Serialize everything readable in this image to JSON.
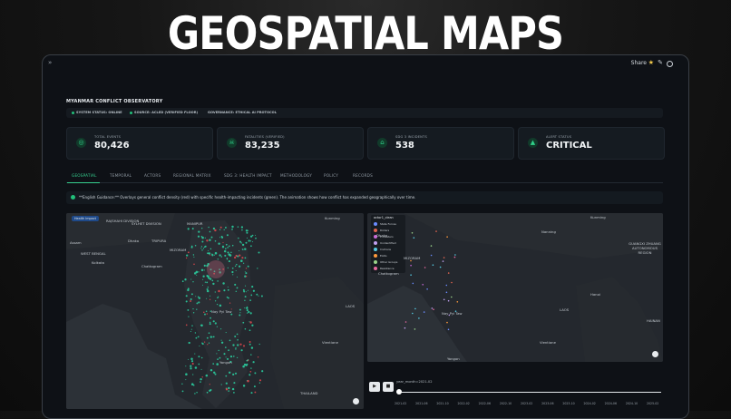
{
  "headline": "GEOSPATIAL MAPS",
  "topbar": {
    "collapse": "»",
    "share": "Share",
    "star_icon": "star-icon",
    "pencil_icon": "pencil-icon",
    "github_icon": "github-icon"
  },
  "dashboard": {
    "title": "MYANMAR CONFLICT OBSERVATORY",
    "status": [
      "SYSTEM STATUS: ONLINE",
      "SOURCE: ACLED (VERIFIED FLOOR)",
      "GOVERNANCE: ETHICAL AI PROTOCOL"
    ]
  },
  "kpis": [
    {
      "label": "TOTAL EVENTS",
      "value": "80,426",
      "icon": "target-icon"
    },
    {
      "label": "FATALITIES (VERIFIED)",
      "value": "83,235",
      "icon": "skull-icon"
    },
    {
      "label": "SDG 3 INCIDENTS",
      "value": "538",
      "icon": "home-icon"
    },
    {
      "label": "ALERT STATUS",
      "value": "CRITICAL",
      "icon": "warning-icon"
    }
  ],
  "tabs": [
    "GEOSPATIAL",
    "TEMPORAL",
    "ACTORS",
    "REGIONAL MATRIX",
    "SDG 3: HEALTH IMPACT",
    "METHODOLOGY",
    "POLICY",
    "RECORDS"
  ],
  "note": "**English Guidance:** Overlays general conflict density (red) with specific health-impacting incidents (green). The animation shows how conflict has expanded geographically over time.",
  "left_map": {
    "badge": "Health Impact",
    "labels": [
      "SYLHET DIVISION",
      "RAJSHAHI DIVISION",
      "MANIPUR",
      "Kunming",
      "Dhaka",
      "Assam",
      "TRIPURA",
      "MIZORAM",
      "WEST BENGAL",
      "Kolkata",
      "Chattogram",
      "Nay Pyi Taw",
      "LAOS",
      "Yangon",
      "Vientiane",
      "THAILAND"
    ]
  },
  "right_map": {
    "legend_title": "actor1_clean",
    "legend": [
      {
        "name": "State Forces",
        "color": "#6b8cff"
      },
      {
        "name": "Rioters",
        "color": "#e0644f"
      },
      {
        "name": "Protesters",
        "color": "#c96ad8"
      },
      {
        "name": "Unidentified",
        "color": "#c0a0f0"
      },
      {
        "name": "Civilians",
        "color": "#56c8e0"
      },
      {
        "name": "EAOs",
        "color": "#ff9a3c"
      },
      {
        "name": "Other Groups",
        "color": "#9ad38a"
      },
      {
        "name": "Resistance",
        "color": "#e86aa0"
      }
    ],
    "labels": [
      "Kunming",
      "Nanning",
      "GUANGXI ZHUANG AUTONOMOUS REGION",
      "Dhaka",
      "Chattogram",
      "MIZORAM",
      "Nay Pyi Taw",
      "LAOS",
      "Hanoi",
      "HAINAN",
      "Yangon",
      "Vientiane"
    ]
  },
  "animation": {
    "play": "▶",
    "stop": "■",
    "slider_label": "year_month=2021-02",
    "ticks": [
      "2021-02",
      "2021-06",
      "2021-10",
      "2022-02",
      "2022-06",
      "2022-10",
      "2023-02",
      "2023-06",
      "2023-10",
      "2024-02",
      "2024-06",
      "2024-10",
      "2025-02"
    ]
  },
  "colors": {
    "accent": "#36d08f",
    "alert": "#e5484d",
    "health": "#2ad6a4"
  }
}
